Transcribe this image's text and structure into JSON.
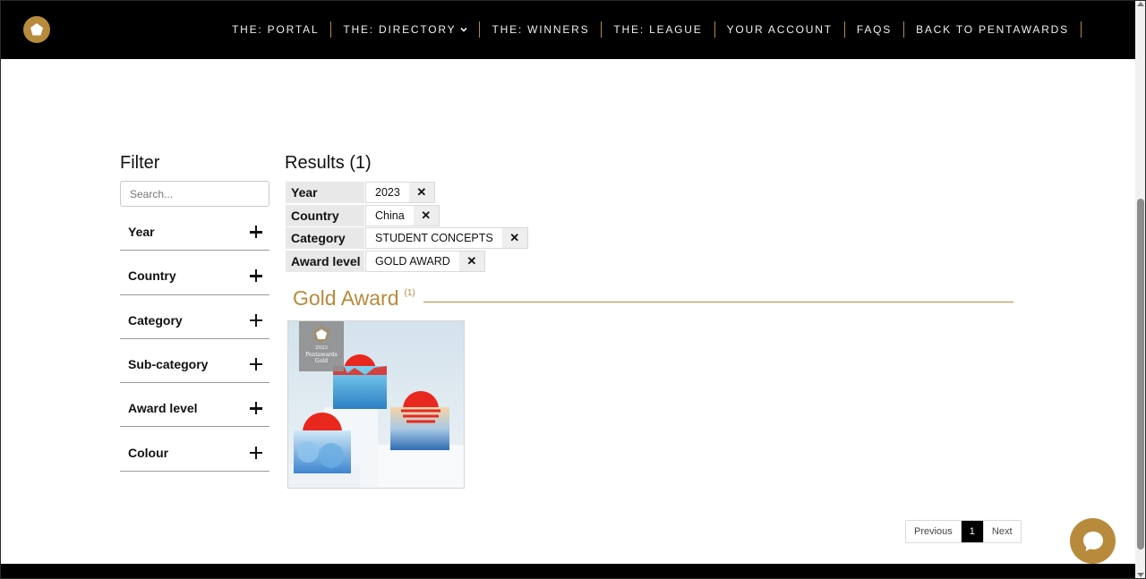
{
  "nav": {
    "items": [
      {
        "label": "THE: PORTAL"
      },
      {
        "label": "THE: DIRECTORY",
        "has_dropdown": true
      },
      {
        "label": "THE: WINNERS"
      },
      {
        "label": "THE: LEAGUE"
      },
      {
        "label": "YOUR ACCOUNT"
      },
      {
        "label": "FAQS"
      },
      {
        "label": "BACK TO PENTAWARDS"
      }
    ]
  },
  "filter": {
    "title": "Filter",
    "search_placeholder": "Search...",
    "facets": [
      {
        "label": "Year"
      },
      {
        "label": "Country"
      },
      {
        "label": "Category"
      },
      {
        "label": "Sub-category"
      },
      {
        "label": "Award level"
      },
      {
        "label": "Colour"
      }
    ]
  },
  "results": {
    "title": "Results (1)",
    "active_filters": [
      {
        "key": "Year",
        "value": "2023"
      },
      {
        "key": "Country",
        "value": "China"
      },
      {
        "key": "Category",
        "value": "STUDENT CONCEPTS"
      },
      {
        "key": "Award level",
        "value": "GOLD AWARD"
      }
    ],
    "group": {
      "title": "Gold Award",
      "count": "(1)"
    },
    "entry": {
      "badge_year": "2023",
      "badge_name": "Pentawards",
      "badge_level": "Gold"
    }
  },
  "pagination": {
    "previous": "Previous",
    "current": "1",
    "next": "Next"
  },
  "colors": {
    "gold": "#b88a3c",
    "nav_bg": "#000000"
  }
}
